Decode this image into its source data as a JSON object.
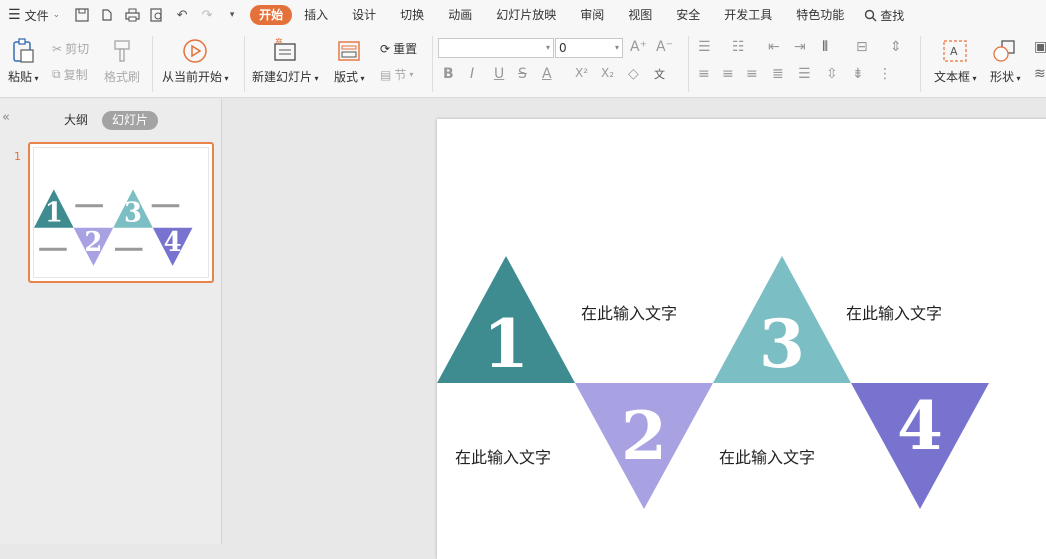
{
  "menubar": {
    "file_label": "文件",
    "tabs": [
      {
        "label": "开始",
        "active": true
      },
      {
        "label": "插入"
      },
      {
        "label": "设计"
      },
      {
        "label": "切换"
      },
      {
        "label": "动画"
      },
      {
        "label": "幻灯片放映"
      },
      {
        "label": "审阅"
      },
      {
        "label": "视图"
      },
      {
        "label": "安全"
      },
      {
        "label": "开发工具"
      },
      {
        "label": "特色功能"
      }
    ],
    "search_label": "查找"
  },
  "ribbon": {
    "paste": "粘贴",
    "cut": "剪切",
    "copy": "复制",
    "format_painter": "格式刷",
    "play_from_current": "从当前开始",
    "new_slide": "新建幻灯片",
    "layout": "版式",
    "reset": "重置",
    "section": "节",
    "font_size": "0",
    "text_box": "文本框",
    "shape": "形状"
  },
  "panel": {
    "tab_outline": "大纲",
    "tab_slides": "幻灯片",
    "slide_number": "1"
  },
  "slide": {
    "shapes": [
      {
        "number": "1",
        "color": "#3e8c90",
        "direction": "up"
      },
      {
        "number": "2",
        "color": "#a8a2e2",
        "direction": "down"
      },
      {
        "number": "3",
        "color": "#7bbec3",
        "direction": "up"
      },
      {
        "number": "4",
        "color": "#7873cf",
        "direction": "down"
      }
    ],
    "text_placeholders": [
      "在此输入文字",
      "在此输入文字",
      "在此输入文字",
      "在此输入文字"
    ]
  },
  "colors": {
    "accent": "#e5713a"
  }
}
